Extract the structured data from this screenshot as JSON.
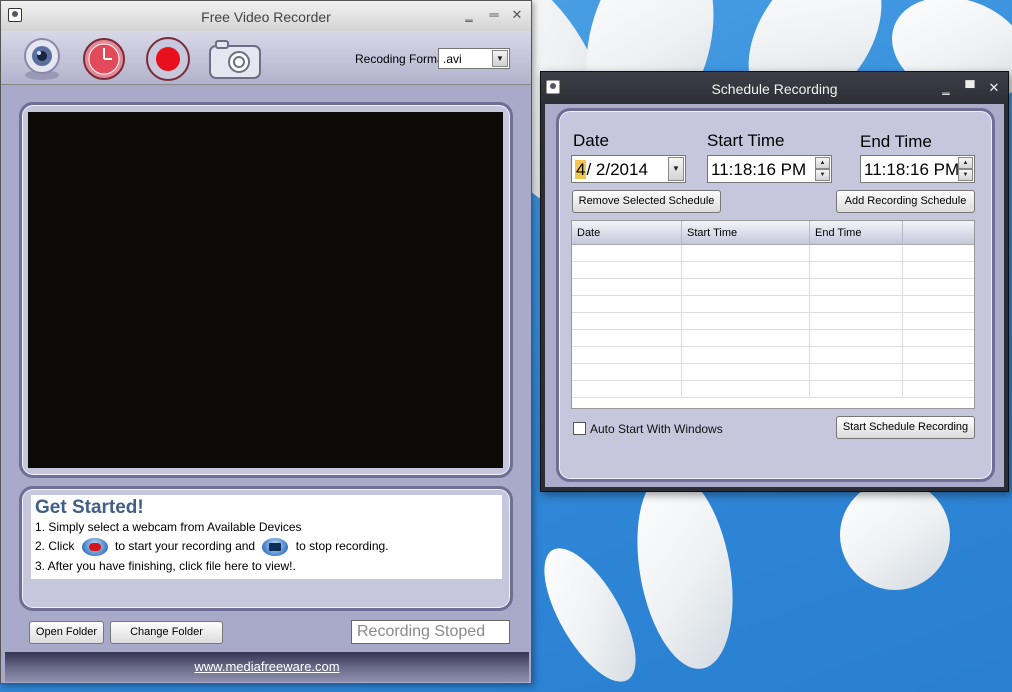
{
  "main_window": {
    "title": "Free Video Recorder",
    "minimize_glyph": "‗",
    "maximize_glyph": "═",
    "close_glyph": "✕",
    "toolbar": {
      "icons": [
        "webcam-icon",
        "schedule-clock-icon",
        "record-icon",
        "snapshot-camera-icon"
      ],
      "format_label": "Recoding Format",
      "format_value": ".avi",
      "dropdown_glyph": "▼"
    },
    "help": {
      "title": "Get Started!",
      "line1": "1. Simply select a webcam from Available Devices",
      "line2_a": "2. Click",
      "line2_b": "to start your recording and",
      "line2_c": "to stop recording.",
      "line3": "3. After you have finishing, click file  here to view!."
    },
    "buttons": {
      "open_folder": "Open Folder",
      "change_folder": "Change Folder"
    },
    "status": "Recording Stoped",
    "footer_link": "www.mediafreeware.com"
  },
  "schedule_window": {
    "title": "Schedule Recording",
    "minimize_glyph": "‗",
    "maximize_glyph": "▀",
    "close_glyph": "✕",
    "date_label": "Date",
    "date_month": "4",
    "date_rest": "/  2/2014",
    "start_label": "Start Time",
    "start_value": "11:18:16 PM",
    "end_label": "End Time",
    "end_value": "11:18:16 PM",
    "spin_up": "▲",
    "spin_down": "▼",
    "dropdown_glyph": "▼",
    "remove_button": "Remove Selected Schedule",
    "add_button": "Add Recording Schedule",
    "table": {
      "columns": [
        "Date",
        "Start Time",
        "End Time",
        ""
      ],
      "rows": 9
    },
    "auto_start_label": "Auto Start With Windows",
    "auto_start_checked": false,
    "start_button": "Start Schedule Recording"
  },
  "colors": {
    "window_bg": "#a9a9c9",
    "panel_border": "#6e6e96",
    "record_red": "#e8101c",
    "help_title": "#3e5f86",
    "desktop_blue": "#3d95df"
  }
}
